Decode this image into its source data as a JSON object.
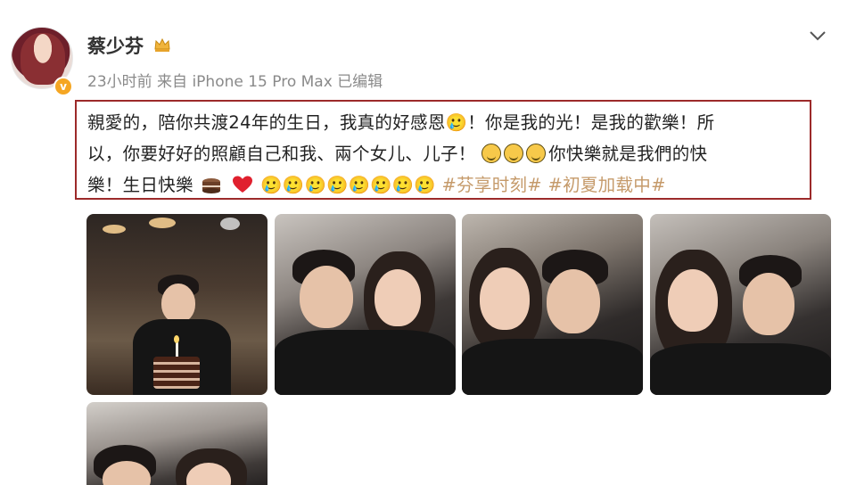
{
  "post": {
    "username": "蔡少芬",
    "meta": "23小时前  来自 iPhone 15 Pro Max  已编辑",
    "text": {
      "line1": "親愛的，陪你共渡24年的生日，我真的好感恩🥲！你是我的光！是我的歡樂！所",
      "line2": "以，你要好好的照顧自己和我、兩个女儿、儿子！",
      "line2_tail": "你快樂就是我們的快",
      "line3_start": "樂！生日快樂",
      "line3_boxes": "🥲🥲🥲🥲🥲🥲🥲🥲",
      "hashtag1": "#芬享时刻#",
      "hashtag2": "#初夏加载中#"
    },
    "icons": {
      "avatar": "avatar-photo",
      "verified": "verified-v-icon",
      "crown": "crown-icon",
      "menu": "chevron-down-icon",
      "laugh": "laughing-emoji-icon",
      "cake": "cake-icon",
      "heart": "heart-icon"
    },
    "verified_label": "v",
    "colors": {
      "highlight_border": "#9c2a2a",
      "hashtag": "#c59a6a",
      "meta": "#8a8a8a",
      "verified": "#f5a623"
    }
  }
}
